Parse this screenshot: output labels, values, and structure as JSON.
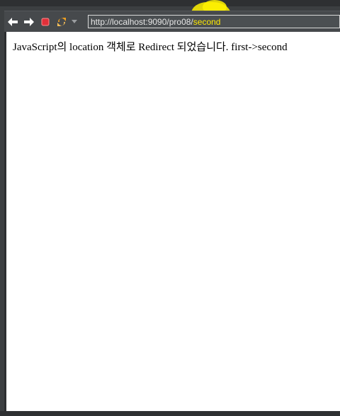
{
  "browser": {
    "url": {
      "prefix": "http://localhost:9090/pro08/",
      "path": "second"
    },
    "toolbar": {
      "back_icon": "arrow-left-icon",
      "forward_icon": "arrow-right-icon",
      "stop_icon": "stop-icon",
      "refresh_icon": "refresh-icon",
      "dropdown_icon": "chevron-down-icon"
    }
  },
  "page": {
    "message": "JavaScript의 location 객체로 Redirect 되었습니다. first->second"
  },
  "colors": {
    "chrome": "#3c3f41",
    "highlight": "#fff200",
    "stop_red": "#e0303a",
    "refresh_orange": "#f0a020"
  }
}
